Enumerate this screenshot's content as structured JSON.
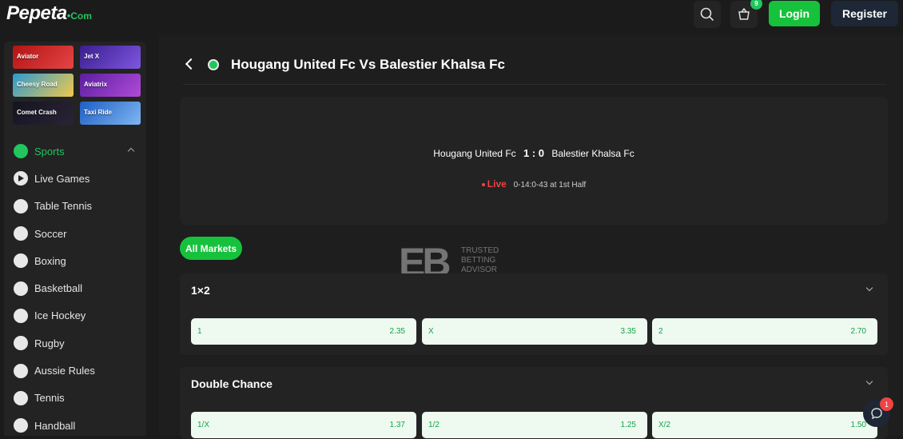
{
  "topbar": {
    "logo_main": "Pepeta",
    "logo_dot": "•",
    "logo_suffix": "Com",
    "cart_badge": "9",
    "login_label": "Login",
    "register_label": "Register"
  },
  "games": [
    {
      "label": "Aviator",
      "color": "#c81d1d"
    },
    {
      "label": "Jet X",
      "color": "#4c2fa8"
    },
    {
      "label": "Cheesy Road",
      "color": "#3ba7d6"
    },
    {
      "label": "Aviatrix",
      "color": "#6b2bb5"
    },
    {
      "label": "Comet Crash",
      "color": "#1c1c2a"
    },
    {
      "label": "Taxi Ride",
      "color": "#2a6bd1"
    }
  ],
  "sidebar": {
    "items": [
      {
        "label": "Sports",
        "icon": "globe-icon"
      },
      {
        "label": "Live Games",
        "icon": "play-icon"
      },
      {
        "label": "Table Tennis",
        "icon": "table-tennis-icon"
      },
      {
        "label": "Soccer",
        "icon": "soccer-ball-icon"
      },
      {
        "label": "Boxing",
        "icon": "boxing-glove-icon"
      },
      {
        "label": "Basketball",
        "icon": "basketball-icon"
      },
      {
        "label": "Ice Hockey",
        "icon": "ice-hockey-icon"
      },
      {
        "label": "Rugby",
        "icon": "rugby-ball-icon"
      },
      {
        "label": "Aussie Rules",
        "icon": "australia-icon"
      },
      {
        "label": "Tennis",
        "icon": "tennis-racket-icon"
      },
      {
        "label": "Handball",
        "icon": "handball-icon"
      }
    ]
  },
  "match": {
    "title": "Hougang United Fc Vs Balestier Khalsa Fc",
    "home": "Hougang United Fc",
    "score": "1 : 0",
    "away": "Balestier Khalsa Fc",
    "live_label": "Live",
    "time_info": "0-14:0-43 at 1st Half"
  },
  "markets_tab": "All Markets",
  "watermark": {
    "mark": "ЕВ",
    "line1": "TRUSTED",
    "line2": "BETTING",
    "line3": "ADVISOR"
  },
  "markets": [
    {
      "title": "1×2",
      "odds": [
        {
          "label": "1",
          "value": "2.35"
        },
        {
          "label": "X",
          "value": "3.35"
        },
        {
          "label": "2",
          "value": "2.70"
        }
      ]
    },
    {
      "title": "Double Chance",
      "odds": [
        {
          "label": "1/X",
          "value": "1.37"
        },
        {
          "label": "1/2",
          "value": "1.25"
        },
        {
          "label": "X/2",
          "value": "1.50"
        }
      ]
    }
  ],
  "chat_badge": "1",
  "colors": {
    "accent": "#16c23c",
    "live": "#ef4444",
    "odd_bg": "#eefaf0"
  }
}
